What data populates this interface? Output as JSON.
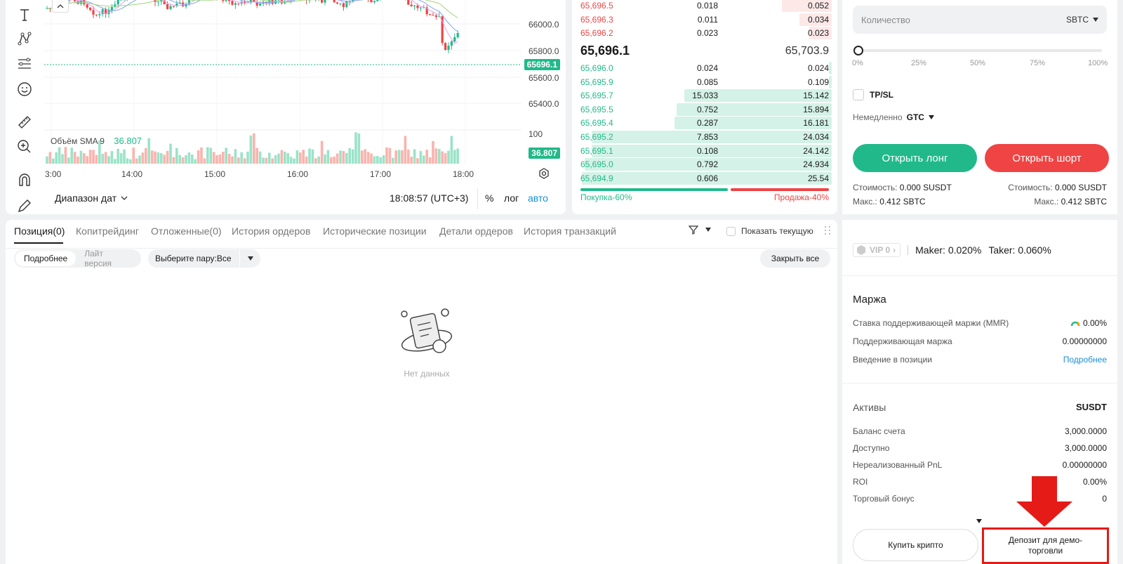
{
  "chart": {
    "price_levels": [
      "66000.0",
      "65800.0",
      "65600.0",
      "65400.0"
    ],
    "current_price_tag": "65696.1",
    "volume_label": "Объём SMA 9",
    "volume_value": "36.807",
    "volume_axis": "100",
    "volume_tag": "36.807",
    "time_labels": [
      "3:00",
      "14:00",
      "15:00",
      "16:00",
      "17:00",
      "18:00"
    ],
    "date_range": "Диапазон дат",
    "clock": "18:08:57 (UTC+3)",
    "pct_label": "%",
    "log_label": "лог",
    "auto_label": "авто",
    "colors": {
      "up": "#21b98a",
      "down": "#ef4444"
    }
  },
  "orderbook": {
    "asks": [
      {
        "price": "65,696.5",
        "qty": "0.018",
        "total": "0.052",
        "depth": 0.2
      },
      {
        "price": "65,696.3",
        "qty": "0.011",
        "total": "0.034",
        "depth": 0.13
      },
      {
        "price": "65,696.2",
        "qty": "0.023",
        "total": "0.023",
        "depth": 0.09
      }
    ],
    "last_price": "65,696.1",
    "mark_price": "65,703.9",
    "bids": [
      {
        "price": "65,696.0",
        "qty": "0.024",
        "total": "0.024",
        "depth": 0.01
      },
      {
        "price": "65,695.9",
        "qty": "0.085",
        "total": "0.109",
        "depth": 0.01
      },
      {
        "price": "65,695.7",
        "qty": "15.033",
        "total": "15.142",
        "depth": 0.59
      },
      {
        "price": "65,695.5",
        "qty": "0.752",
        "total": "15.894",
        "depth": 0.62
      },
      {
        "price": "65,695.4",
        "qty": "0.287",
        "total": "16.181",
        "depth": 0.63
      },
      {
        "price": "65,695.2",
        "qty": "7.853",
        "total": "24.034",
        "depth": 0.96
      },
      {
        "price": "65,695.1",
        "qty": "0.108",
        "total": "24.142",
        "depth": 0.96
      },
      {
        "price": "65,695.0",
        "qty": "0.792",
        "total": "24.934",
        "depth": 0.99
      },
      {
        "price": "65,694.9",
        "qty": "0.606",
        "total": "25.54",
        "depth": 1.0
      }
    ],
    "buy_label": "Покупка-60%",
    "sell_label": "Продажа-40%",
    "buy_ratio": 0.6
  },
  "orders": {
    "tabs": [
      "Позиция(0)",
      "Копитрейдинг",
      "Отложенные(0)",
      "История ордеров",
      "Исторические позиции",
      "Детали ордеров",
      "История транзакций"
    ],
    "show_current": "Показать текущую",
    "view_detailed": "Подробнее",
    "view_lite": "Лайт версия",
    "pair_select": "Выберите пару:Все",
    "close_all": "Закрыть все",
    "empty_text": "Нет данных"
  },
  "trade": {
    "qty_placeholder": "Количество",
    "qty_unit": "SBTC",
    "slider_marks": [
      "0%",
      "25%",
      "50%",
      "75%",
      "100%"
    ],
    "tpsl_label": "TP/SL",
    "tif_label": "Немедленно",
    "tif_value": "GTC",
    "open_long": "Открыть лонг",
    "open_short": "Открыть шорт",
    "cost_left_label": "Стоимость:",
    "cost_left_value": "0.000 SUSDT",
    "cost_right_label": "Стоимость:",
    "cost_right_value": "0.000 SUSDT",
    "max_left_label": "Макс.:",
    "max_left_value": "0.412 SBTC",
    "max_right_label": "Макс.:",
    "max_right_value": "0.412 SBTC",
    "vip_label": "VIP 0",
    "maker": "Maker: 0.020%",
    "taker": "Taker: 0.060%",
    "colors": {
      "long": "#21b98a",
      "short": "#ef4444"
    }
  },
  "margin": {
    "title": "Маржа",
    "mmr_label": "Ставка поддерживающей маржи (MMR)",
    "mmr_value": "0.00%",
    "maint_label": "Поддерживающая маржа",
    "maint_value": "0.00000000",
    "intro_label": "Введение в позиции",
    "intro_link": "Подробнее"
  },
  "assets": {
    "title": "Активы",
    "currency": "SUSDT",
    "rows": [
      {
        "label": "Баланс счета",
        "value": "3,000.0000"
      },
      {
        "label": "Доступно",
        "value": "3,000.0000"
      },
      {
        "label": "Нереализованный PnL",
        "value": "0.00000000"
      },
      {
        "label": "ROI",
        "value": "0.00%"
      },
      {
        "label": "Торговый бонус",
        "value": "0"
      }
    ],
    "buy_crypto": "Купить крипто",
    "demo_deposit": "Депозит для демо-торговли"
  }
}
